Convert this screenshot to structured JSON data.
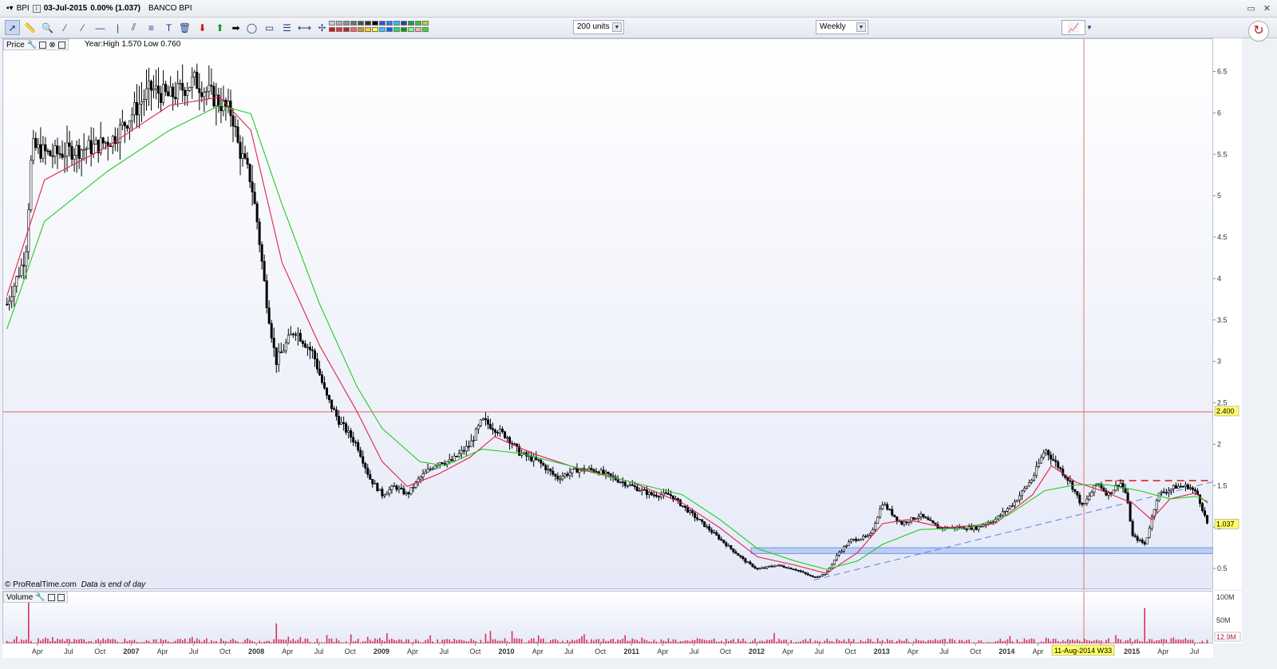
{
  "titlebar": {
    "symbol": "BPI",
    "info_icon": "i",
    "date_status": "03-Jul-2015",
    "change": "0.00% (1.037)",
    "name": "BANCO BPI"
  },
  "toolbar": {
    "units_select": "200 units",
    "period_select": "Weekly"
  },
  "price_panel": {
    "label": "Price",
    "year_info": "Year:High 1.570 Low 0.760",
    "credit": "© ProRealTime.com",
    "credit_note": "Data is end of day",
    "last_price_tag": "1.037",
    "line_tag": "2.400",
    "cursor_date_tag": "11-Aug-2014 W33"
  },
  "volume_panel": {
    "label": "Volume",
    "last_volume_tag": "12.9M"
  },
  "colors": {
    "candle": "#000000",
    "ma_fast": "#e0204a",
    "ma_slow": "#22cc22",
    "horizontal_line": "#e05050",
    "resistance_dash": "#e02020",
    "support_zone": "#6f98e8",
    "trendline": "#5a82e0",
    "volume": "#d8305a",
    "tag_yellow": "#ffff66"
  },
  "chart_data": {
    "type": "candlestick",
    "title": "BANCO BPI",
    "period": "Weekly",
    "ylim": [
      0.25,
      6.9
    ],
    "y_ticks": [
      "0.5",
      "1",
      "1.5",
      "2",
      "2.5",
      "3",
      "3.5",
      "4",
      "4.5",
      "5",
      "5.5",
      "6",
      "6.5"
    ],
    "x_ticks": [
      "Apr",
      "Jul",
      "Oct",
      "2007",
      "Apr",
      "Jul",
      "Oct",
      "2008",
      "Apr",
      "Jul",
      "Oct",
      "2009",
      "Apr",
      "Jul",
      "Oct",
      "2010",
      "Apr",
      "Jul",
      "Oct",
      "2011",
      "Apr",
      "Jul",
      "Oct",
      "2012",
      "Apr",
      "Jul",
      "Oct",
      "2013",
      "Apr",
      "Jul",
      "Oct",
      "2014",
      "Apr",
      "Jul",
      "Oct",
      "2015",
      "Apr",
      "Jul"
    ],
    "price_path": [
      [
        2006.0,
        3.7
      ],
      [
        2006.15,
        4.3
      ],
      [
        2006.2,
        5.6
      ],
      [
        2006.35,
        5.5
      ],
      [
        2006.5,
        5.55
      ],
      [
        2006.7,
        5.6
      ],
      [
        2006.85,
        5.7
      ],
      [
        2007.0,
        6.0
      ],
      [
        2007.15,
        6.3
      ],
      [
        2007.3,
        6.2
      ],
      [
        2007.5,
        6.4
      ],
      [
        2007.65,
        6.2
      ],
      [
        2007.8,
        6.0
      ],
      [
        2007.85,
        5.6
      ],
      [
        2007.95,
        5.2
      ],
      [
        2008.0,
        4.7
      ],
      [
        2008.07,
        3.8
      ],
      [
        2008.15,
        3.0
      ],
      [
        2008.3,
        3.4
      ],
      [
        2008.45,
        3.1
      ],
      [
        2008.55,
        2.6
      ],
      [
        2008.65,
        2.3
      ],
      [
        2008.8,
        2.0
      ],
      [
        2008.9,
        1.6
      ],
      [
        2009.0,
        1.4
      ],
      [
        2009.1,
        1.5
      ],
      [
        2009.2,
        1.4
      ],
      [
        2009.3,
        1.6
      ],
      [
        2009.45,
        1.8
      ],
      [
        2009.55,
        1.8
      ],
      [
        2009.7,
        2.0
      ],
      [
        2009.8,
        2.3
      ],
      [
        2009.9,
        2.2
      ],
      [
        2010.0,
        2.1
      ],
      [
        2010.1,
        1.9
      ],
      [
        2010.25,
        1.8
      ],
      [
        2010.4,
        1.6
      ],
      [
        2010.55,
        1.7
      ],
      [
        2010.7,
        1.7
      ],
      [
        2010.85,
        1.6
      ],
      [
        2011.0,
        1.5
      ],
      [
        2011.15,
        1.4
      ],
      [
        2011.3,
        1.4
      ],
      [
        2011.45,
        1.2
      ],
      [
        2011.6,
        1.0
      ],
      [
        2011.75,
        0.8
      ],
      [
        2011.9,
        0.6
      ],
      [
        2012.0,
        0.5
      ],
      [
        2012.15,
        0.55
      ],
      [
        2012.3,
        0.5
      ],
      [
        2012.45,
        0.4
      ],
      [
        2012.55,
        0.45
      ],
      [
        2012.65,
        0.7
      ],
      [
        2012.75,
        0.85
      ],
      [
        2012.9,
        0.9
      ],
      [
        2013.0,
        1.3
      ],
      [
        2013.15,
        1.05
      ],
      [
        2013.3,
        1.15
      ],
      [
        2013.45,
        1.0
      ],
      [
        2013.6,
        1.0
      ],
      [
        2013.75,
        1.0
      ],
      [
        2013.9,
        1.1
      ],
      [
        2014.05,
        1.3
      ],
      [
        2014.2,
        1.6
      ],
      [
        2014.3,
        1.95
      ],
      [
        2014.4,
        1.75
      ],
      [
        2014.5,
        1.55
      ],
      [
        2014.6,
        1.25
      ],
      [
        2014.72,
        1.55
      ],
      [
        2014.8,
        1.4
      ],
      [
        2014.9,
        1.55
      ],
      [
        2014.95,
        1.4
      ],
      [
        2015.0,
        0.9
      ],
      [
        2015.1,
        0.8
      ],
      [
        2015.2,
        1.4
      ],
      [
        2015.35,
        1.5
      ],
      [
        2015.45,
        1.5
      ],
      [
        2015.52,
        1.4
      ],
      [
        2015.6,
        1.037
      ]
    ],
    "moving_averages": [
      {
        "color": "#e0204a",
        "points": [
          [
            2006.0,
            3.8
          ],
          [
            2006.3,
            5.2
          ],
          [
            2006.8,
            5.6
          ],
          [
            2007.3,
            6.1
          ],
          [
            2007.7,
            6.2
          ],
          [
            2007.95,
            5.8
          ],
          [
            2008.2,
            4.2
          ],
          [
            2008.5,
            3.2
          ],
          [
            2008.8,
            2.4
          ],
          [
            2009.0,
            1.8
          ],
          [
            2009.2,
            1.5
          ],
          [
            2009.45,
            1.65
          ],
          [
            2009.7,
            1.85
          ],
          [
            2009.9,
            2.1
          ],
          [
            2010.2,
            1.9
          ],
          [
            2010.6,
            1.7
          ],
          [
            2011.0,
            1.55
          ],
          [
            2011.4,
            1.3
          ],
          [
            2011.7,
            1.0
          ],
          [
            2012.0,
            0.65
          ],
          [
            2012.3,
            0.55
          ],
          [
            2012.55,
            0.45
          ],
          [
            2012.8,
            0.7
          ],
          [
            2013.0,
            1.05
          ],
          [
            2013.2,
            1.1
          ],
          [
            2013.5,
            1.0
          ],
          [
            2013.9,
            1.05
          ],
          [
            2014.2,
            1.4
          ],
          [
            2014.35,
            1.75
          ],
          [
            2014.55,
            1.55
          ],
          [
            2014.75,
            1.45
          ],
          [
            2015.0,
            1.3
          ],
          [
            2015.15,
            1.1
          ],
          [
            2015.3,
            1.35
          ],
          [
            2015.5,
            1.42
          ],
          [
            2015.6,
            1.3
          ]
        ]
      },
      {
        "color": "#22cc22",
        "points": [
          [
            2006.0,
            3.4
          ],
          [
            2006.3,
            4.7
          ],
          [
            2006.8,
            5.3
          ],
          [
            2007.3,
            5.8
          ],
          [
            2007.7,
            6.1
          ],
          [
            2007.95,
            6.0
          ],
          [
            2008.2,
            4.9
          ],
          [
            2008.5,
            3.7
          ],
          [
            2008.8,
            2.7
          ],
          [
            2009.0,
            2.2
          ],
          [
            2009.3,
            1.8
          ],
          [
            2009.5,
            1.75
          ],
          [
            2009.8,
            1.95
          ],
          [
            2010.1,
            1.9
          ],
          [
            2010.5,
            1.75
          ],
          [
            2011.0,
            1.55
          ],
          [
            2011.4,
            1.4
          ],
          [
            2011.7,
            1.1
          ],
          [
            2012.0,
            0.75
          ],
          [
            2012.3,
            0.6
          ],
          [
            2012.55,
            0.5
          ],
          [
            2012.8,
            0.6
          ],
          [
            2013.0,
            0.8
          ],
          [
            2013.3,
            0.98
          ],
          [
            2013.7,
            1.0
          ],
          [
            2014.0,
            1.15
          ],
          [
            2014.3,
            1.45
          ],
          [
            2014.55,
            1.52
          ],
          [
            2014.8,
            1.52
          ],
          [
            2015.05,
            1.45
          ],
          [
            2015.3,
            1.35
          ],
          [
            2015.5,
            1.38
          ],
          [
            2015.6,
            1.32
          ]
        ]
      }
    ],
    "annotations": {
      "horizontal_line": 2.4,
      "resistance_level": 1.57,
      "support_zone": [
        0.69,
        0.76
      ],
      "trendline": [
        [
          2012.45,
          0.37
        ],
        [
          2015.6,
          1.54
        ]
      ],
      "cursor_date": 2014.61
    },
    "volume_ylim": [
      0,
      110
    ],
    "volume_ticks": [
      "100M",
      "50M"
    ],
    "volume_spikes": [
      [
        2006.18,
        100
      ],
      [
        2008.15,
        45
      ],
      [
        2015.1,
        78
      ]
    ],
    "x_range": [
      2005.97,
      2015.65
    ]
  }
}
